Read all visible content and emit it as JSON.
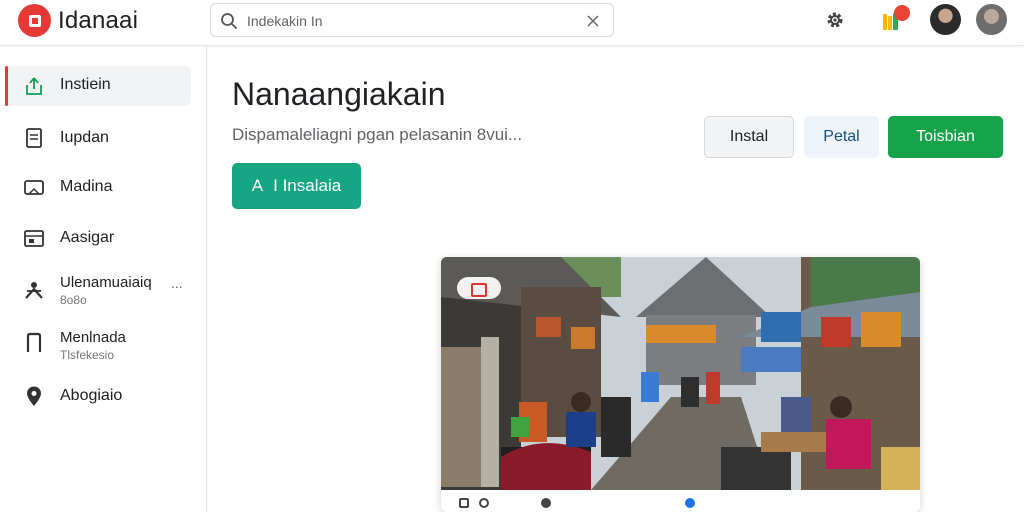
{
  "app": {
    "title": "Idanaai"
  },
  "search": {
    "value": "Indekakin In"
  },
  "sidebar": {
    "items": [
      {
        "label": "Instiein",
        "sub": "",
        "active": true
      },
      {
        "label": "Iupdan",
        "sub": ""
      },
      {
        "label": "Madina",
        "sub": ""
      },
      {
        "label": "Aasigar",
        "sub": ""
      },
      {
        "label": "Ulenamuaiaiq",
        "sub": "8o8o",
        "more": "..."
      },
      {
        "label": "Menlnada",
        "sub": "Tlsfekesio"
      },
      {
        "label": "Abogiaio",
        "sub": ""
      }
    ]
  },
  "main": {
    "title": "Nanaangiakain",
    "description": "Dispamaleliagni pgan pelasanin 8vui...",
    "buttons": {
      "install": "Instal",
      "petal": "Petal",
      "primary": "Toisbian",
      "action_icon": "A",
      "action": "I Insalaia"
    }
  },
  "colors": {
    "brand": "#e53935",
    "primary_green": "#16a34a",
    "teal_green": "#16a683",
    "petal_bg": "#eef4fa"
  },
  "icons": [
    "logo-icon",
    "search-icon",
    "close-icon",
    "settings-icon",
    "notification-icon",
    "upload-icon",
    "document-icon",
    "media-icon",
    "calendar-icon",
    "people-icon",
    "door-icon",
    "location-pin-icon"
  ]
}
